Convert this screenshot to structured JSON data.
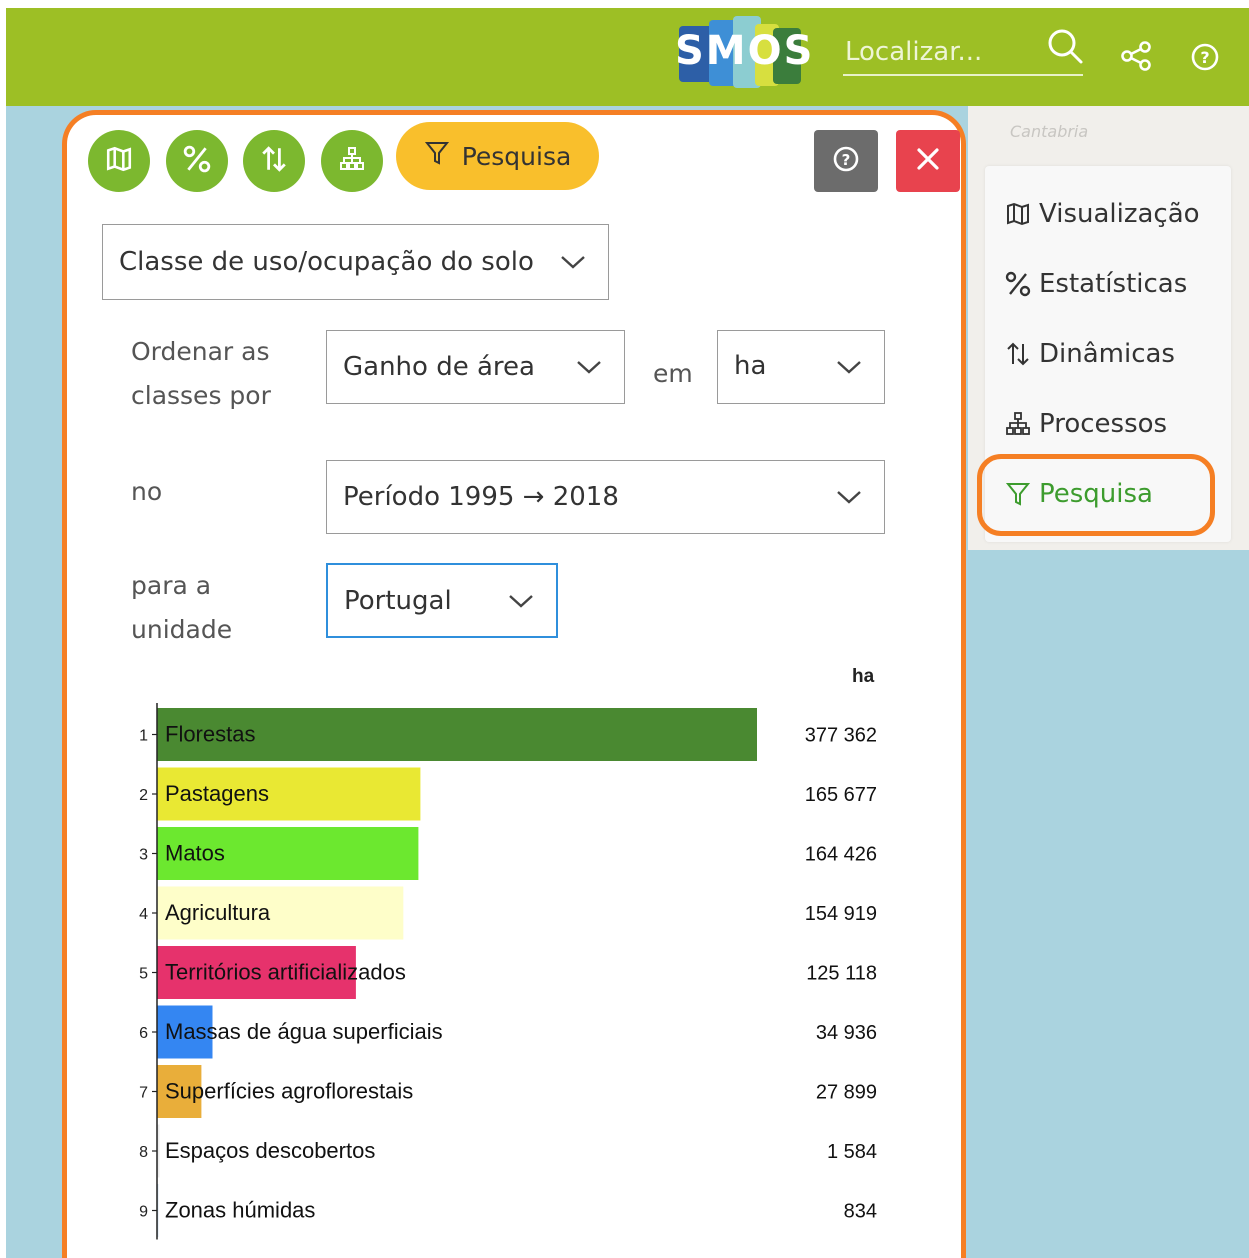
{
  "header": {
    "logo_text": "SMOS",
    "search_placeholder": "Localizar...",
    "icons": [
      "search-icon",
      "share-icon",
      "help-icon"
    ]
  },
  "map": {
    "label": "Cantabria"
  },
  "toolbar": {
    "buttons": [
      "map-icon",
      "percent-icon",
      "sort-arrows-icon",
      "hierarchy-icon"
    ],
    "pesquisa_label": "Pesquisa",
    "help_icon": "help-icon",
    "close_icon": "close-icon"
  },
  "form": {
    "class_select": "Classe de uso/ocupação do solo",
    "order_label_line1": "Ordenar as",
    "order_label_line2": "classes por",
    "order_select": "Ganho de área",
    "em_label": "em",
    "unit_select": "ha",
    "period_label": "no",
    "period_select": "Período 1995 → 2018",
    "unit_label_line1": "para a",
    "unit_label_line2": "unidade",
    "region_select": "Portugal"
  },
  "sidenav": {
    "items": [
      {
        "label": "Visualização",
        "icon": "map-icon"
      },
      {
        "label": "Estatísticas",
        "icon": "percent-icon"
      },
      {
        "label": "Dinâmicas",
        "icon": "sort-arrows-icon"
      },
      {
        "label": "Processos",
        "icon": "hierarchy-icon"
      },
      {
        "label": "Pesquisa",
        "icon": "filter-icon"
      }
    ],
    "active": "Pesquisa"
  },
  "colors": {
    "topbar": "#9dbf25",
    "panel_highlight": "#f57f24",
    "circle_buttons": "#7cb82f",
    "pesquisa_button": "#f9bf2c",
    "close_button": "#e8434e",
    "active_nav": "#3d9c2e"
  },
  "chart_data": {
    "type": "bar",
    "orientation": "horizontal",
    "unit": "ha",
    "ranks": [
      1,
      2,
      3,
      4,
      5,
      6,
      7,
      8,
      9
    ],
    "categories": [
      "Florestas",
      "Pastagens",
      "Matos",
      "Agricultura",
      "Territórios artificializados",
      "Massas de água superficiais",
      "Superfícies agroflorestais",
      "Espaços descobertos",
      "Zonas húmidas"
    ],
    "values": [
      377362,
      165677,
      164426,
      154919,
      125118,
      34936,
      27899,
      1584,
      834
    ],
    "value_labels": [
      "377 362",
      "165 677",
      "164 426",
      "154 919",
      "125 118",
      "34 936",
      "27 899",
      "1 584",
      "834"
    ],
    "colors": [
      "#4a8931",
      "#e9e833",
      "#6ce82f",
      "#fefec9",
      "#e6326c",
      "#3486f2",
      "#e9ae3a",
      "#ececec",
      "#bfd6e6"
    ]
  }
}
